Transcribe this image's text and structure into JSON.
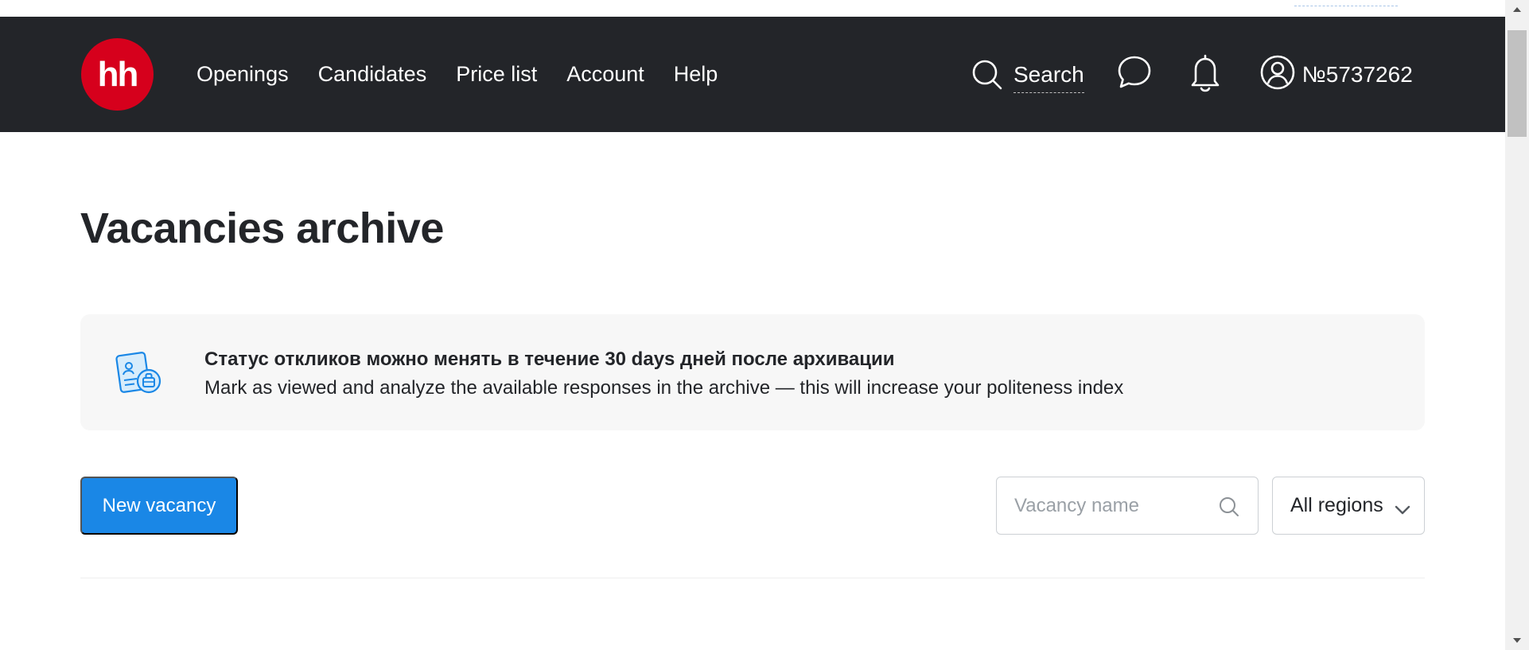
{
  "header": {
    "logo_text": "hh",
    "nav": [
      "Openings",
      "Candidates",
      "Price list",
      "Account",
      "Help"
    ],
    "search_label": "Search",
    "account_id": "№5737262",
    "icons": [
      "search-icon",
      "chat-icon",
      "bell-icon",
      "user-icon"
    ]
  },
  "page": {
    "title": "Vacancies archive"
  },
  "banner": {
    "title": "Статус откликов можно менять в течение 30 days дней после архивации",
    "text": "Mark as viewed and analyze the available responses in the archive — this will increase your politeness index",
    "icon": "archive-document-icon"
  },
  "controls": {
    "new_vacancy_label": "New vacancy",
    "search_placeholder": "Vacancy name",
    "search_value": "",
    "region_selected": "All regions"
  },
  "colors": {
    "header_bg": "#232529",
    "logo_red": "#d6001c",
    "primary_button": "#1a87e6",
    "banner_bg": "#f7f7f7"
  }
}
